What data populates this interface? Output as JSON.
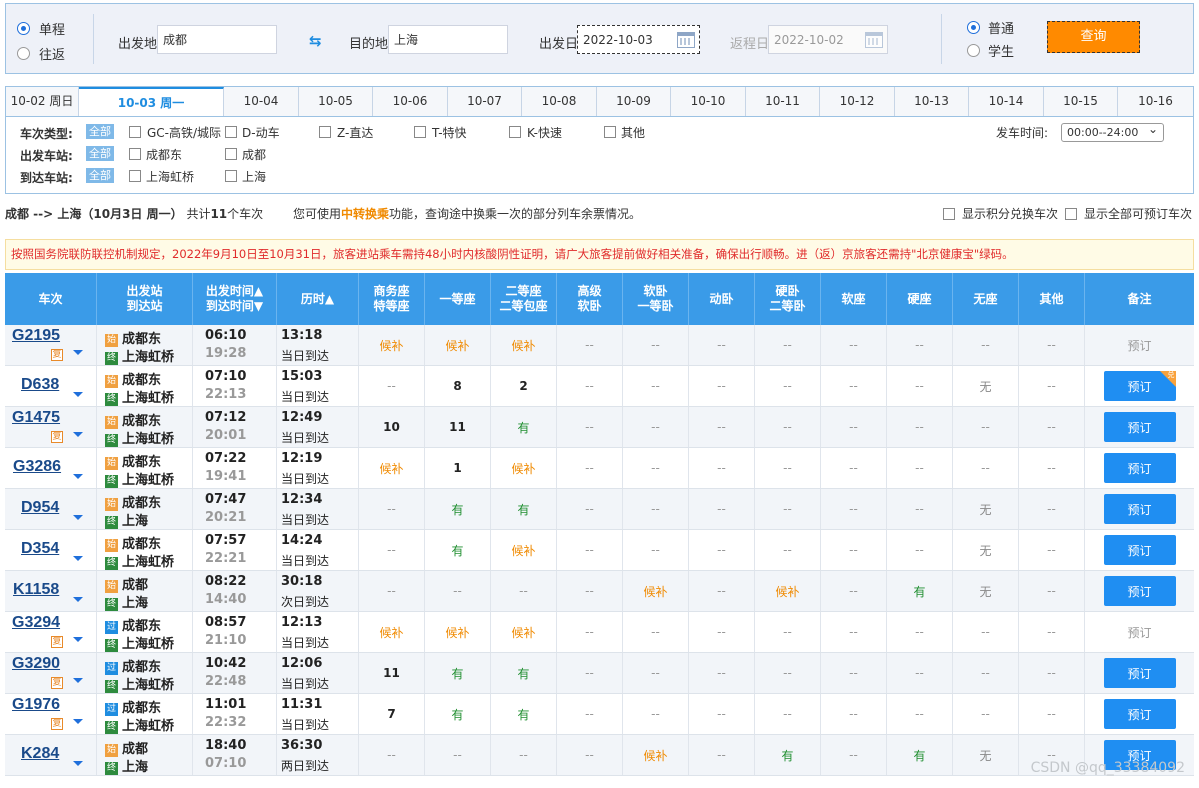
{
  "query": {
    "trip_types": [
      "单程",
      "往返"
    ],
    "from_label": "出发地",
    "from_value": "成都",
    "to_label": "目的地",
    "to_value": "上海",
    "depart_label": "出发日",
    "depart_value": "2022-10-03",
    "return_label": "返程日",
    "return_value": "2022-10-02",
    "passenger_types": [
      "普通",
      "学生"
    ],
    "search_button": "查询"
  },
  "dates": [
    "10-02 周日",
    "10-03 周一",
    "10-04",
    "10-05",
    "10-06",
    "10-07",
    "10-08",
    "10-09",
    "10-10",
    "10-11",
    "10-12",
    "10-13",
    "10-14",
    "10-15",
    "10-16"
  ],
  "filters": {
    "train_type_label": "车次类型:",
    "all_label": "全部",
    "train_types": [
      "GC-高铁/城际",
      "D-动车",
      "Z-直达",
      "T-特快",
      "K-快速",
      "其他"
    ],
    "depart_station_label": "出发车站:",
    "depart_stations": [
      "成都东",
      "成都"
    ],
    "arrive_station_label": "到达车站:",
    "arrive_stations": [
      "上海虹桥",
      "上海"
    ],
    "depart_time_label": "发车时间:",
    "depart_time_value": "00:00--24:00"
  },
  "summary": {
    "route": "成都 --> 上海（10月3日  周一）",
    "count_prefix": "共计",
    "count": "11",
    "count_suffix": "个车次",
    "hint_prefix": "您可使用",
    "hint_link": "中转换乘",
    "hint_suffix": "功能，查询途中换乘一次的部分列车余票情况。",
    "opt1": "显示积分兑换车次",
    "opt2": "显示全部可预订车次"
  },
  "notice": "按照国务院联防联控机制规定，2022年9月10日至10月31日，旅客进站乘车需持48小时内核酸阴性证明，请广大旅客提前做好相关准备，确保出行顺畅。进（返）京旅客还需持\"北京健康宝\"绿码。",
  "headers": [
    [
      "车次"
    ],
    [
      "出发站",
      "到达站"
    ],
    [
      "出发时间▲",
      "到达时间▼"
    ],
    [
      "历时▲"
    ],
    [
      "商务座",
      "特等座"
    ],
    [
      "一等座"
    ],
    [
      "二等座",
      "二等包座"
    ],
    [
      "高级",
      "软卧"
    ],
    [
      "软卧",
      "一等卧"
    ],
    [
      "动卧"
    ],
    [
      "硬卧",
      "二等卧"
    ],
    [
      "软座"
    ],
    [
      "硬座"
    ],
    [
      "无座"
    ],
    [
      "其他"
    ],
    [
      "备注"
    ]
  ],
  "trains": [
    {
      "no": "G2195",
      "fu": true,
      "from_tag": "始",
      "from": "成都东",
      "to_tag": "终",
      "to": "上海虹桥",
      "dep": "06:10",
      "arr": "19:28",
      "dur": "13:18",
      "day": "当日到达",
      "seats": [
        "候补",
        "候补",
        "候补",
        "--",
        "--",
        "--",
        "--",
        "--",
        "--",
        "--",
        "--"
      ],
      "book": "预订",
      "bookable": false
    },
    {
      "no": "D638",
      "fu": false,
      "from_tag": "始",
      "from": "成都东",
      "to_tag": "终",
      "to": "上海虹桥",
      "dep": "07:10",
      "arr": "22:13",
      "dur": "15:03",
      "day": "当日到达",
      "seats": [
        "--",
        "8",
        "2",
        "--",
        "--",
        "--",
        "--",
        "--",
        "--",
        "无",
        "--"
      ],
      "book": "预订",
      "bookable": true,
      "corner": "兑"
    },
    {
      "no": "G1475",
      "fu": true,
      "from_tag": "始",
      "from": "成都东",
      "to_tag": "终",
      "to": "上海虹桥",
      "dep": "07:12",
      "arr": "20:01",
      "dur": "12:49",
      "day": "当日到达",
      "seats": [
        "10",
        "11",
        "有",
        "--",
        "--",
        "--",
        "--",
        "--",
        "--",
        "--",
        "--"
      ],
      "book": "预订",
      "bookable": true
    },
    {
      "no": "G3286",
      "fu": false,
      "from_tag": "始",
      "from": "成都东",
      "to_tag": "终",
      "to": "上海虹桥",
      "dep": "07:22",
      "arr": "19:41",
      "dur": "12:19",
      "day": "当日到达",
      "seats": [
        "候补",
        "1",
        "候补",
        "--",
        "--",
        "--",
        "--",
        "--",
        "--",
        "--",
        "--"
      ],
      "book": "预订",
      "bookable": true
    },
    {
      "no": "D954",
      "fu": false,
      "from_tag": "始",
      "from": "成都东",
      "to_tag": "终",
      "to": "上海",
      "dep": "07:47",
      "arr": "20:21",
      "dur": "12:34",
      "day": "当日到达",
      "seats": [
        "--",
        "有",
        "有",
        "--",
        "--",
        "--",
        "--",
        "--",
        "--",
        "无",
        "--"
      ],
      "book": "预订",
      "bookable": true
    },
    {
      "no": "D354",
      "fu": false,
      "from_tag": "始",
      "from": "成都东",
      "to_tag": "终",
      "to": "上海虹桥",
      "dep": "07:57",
      "arr": "22:21",
      "dur": "14:24",
      "day": "当日到达",
      "seats": [
        "--",
        "有",
        "候补",
        "--",
        "--",
        "--",
        "--",
        "--",
        "--",
        "无",
        "--"
      ],
      "book": "预订",
      "bookable": true
    },
    {
      "no": "K1158",
      "fu": false,
      "from_tag": "始",
      "from": "成都",
      "to_tag": "终",
      "to": "上海",
      "dep": "08:22",
      "arr": "14:40",
      "dur": "30:18",
      "day": "次日到达",
      "seats": [
        "--",
        "--",
        "--",
        "--",
        "候补",
        "--",
        "候补",
        "--",
        "有",
        "无",
        "--"
      ],
      "book": "预订",
      "bookable": true
    },
    {
      "no": "G3294",
      "fu": true,
      "from_tag": "过",
      "from": "成都东",
      "to_tag": "终",
      "to": "上海虹桥",
      "dep": "08:57",
      "arr": "21:10",
      "dur": "12:13",
      "day": "当日到达",
      "seats": [
        "候补",
        "候补",
        "候补",
        "--",
        "--",
        "--",
        "--",
        "--",
        "--",
        "--",
        "--"
      ],
      "book": "预订",
      "bookable": false
    },
    {
      "no": "G3290",
      "fu": true,
      "from_tag": "过",
      "from": "成都东",
      "to_tag": "终",
      "to": "上海虹桥",
      "dep": "10:42",
      "arr": "22:48",
      "dur": "12:06",
      "day": "当日到达",
      "seats": [
        "11",
        "有",
        "有",
        "--",
        "--",
        "--",
        "--",
        "--",
        "--",
        "--",
        "--"
      ],
      "book": "预订",
      "bookable": true
    },
    {
      "no": "G1976",
      "fu": true,
      "from_tag": "过",
      "from": "成都东",
      "to_tag": "终",
      "to": "上海虹桥",
      "dep": "11:01",
      "arr": "22:32",
      "dur": "11:31",
      "day": "当日到达",
      "seats": [
        "7",
        "有",
        "有",
        "--",
        "--",
        "--",
        "--",
        "--",
        "--",
        "--",
        "--"
      ],
      "book": "预订",
      "bookable": true
    },
    {
      "no": "K284",
      "fu": false,
      "from_tag": "始",
      "from": "成都",
      "to_tag": "终",
      "to": "上海",
      "dep": "18:40",
      "arr": "07:10",
      "dur": "36:30",
      "day": "两日到达",
      "seats": [
        "--",
        "--",
        "--",
        "--",
        "候补",
        "--",
        "有",
        "--",
        "有",
        "无",
        "--"
      ],
      "book": "预订",
      "bookable": true
    }
  ],
  "watermark": "CSDN @qq_33384092",
  "colors": {
    "accent": "#3a9be8",
    "search_button": "#ff8a00",
    "available": "#1f8e2f",
    "waitlist": "#f08a00"
  }
}
